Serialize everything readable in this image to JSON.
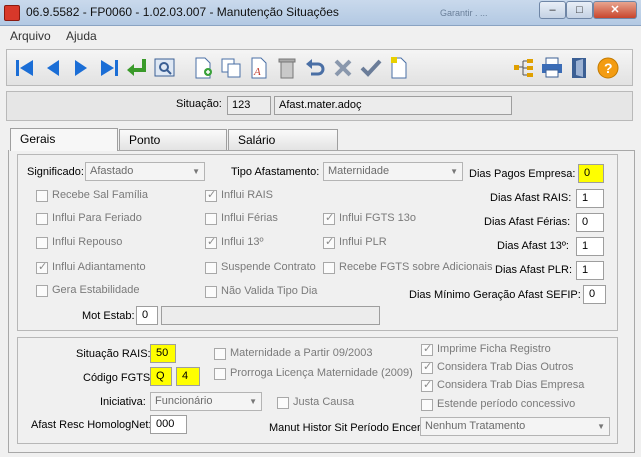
{
  "window": {
    "title": "06.9.5582 - FP0060 - 1.02.03.007 - Manutenção Situações",
    "ghost_text": "Garantir . ..."
  },
  "menu": {
    "items": [
      "Arquivo",
      "Ajuda"
    ]
  },
  "toolbar": {
    "left_icons": [
      "first-icon",
      "previous-icon",
      "next-icon",
      "last-icon",
      "goto-icon",
      "search-icon",
      "new-icon",
      "copy-icon",
      "edit-icon",
      "delete-icon",
      "undo-icon",
      "cancel-icon",
      "confirm-icon",
      "new-document-icon"
    ],
    "right_icons": [
      "tree-icon",
      "print-icon",
      "exit-icon",
      "help-icon"
    ]
  },
  "header": {
    "situacao_label": "Situação:",
    "situacao_code": "123",
    "situacao_desc": "Afast.mater.adoç"
  },
  "tabs": [
    "Gerais",
    "Ponto",
    "Salário"
  ],
  "gerais": {
    "significado_label": "Significado:",
    "significado_value": "Afastado",
    "tipo_afastamento_label": "Tipo Afastamento:",
    "tipo_afastamento_value": "Maternidade",
    "checkboxes": {
      "recebe_sal_familia": "Recebe Sal Família",
      "influi_rais": "Influi RAIS",
      "influi_para_feriado": "Influi Para Feriado",
      "influi_ferias": "Influi Férias",
      "influi_fgts_13o": "Influi FGTS 13o",
      "influi_repouso": "Influi Repouso",
      "influi_13o": "Influi 13º",
      "influi_plr": "Influi PLR",
      "influi_adiantamento": "Influi Adiantamento",
      "suspende_contrato": "Suspende Contrato",
      "recebe_fgts_adicionais": "Recebe FGTS sobre Adicionais",
      "gera_estabilidade": "Gera Estabilidade",
      "nao_valida_tipo_dia": "Não Valida Tipo Dia"
    },
    "dias_pagos_empresa_label": "Dias Pagos Empresa:",
    "dias_pagos_empresa": "0",
    "dias_afast_rais_label": "Dias Afast RAIS:",
    "dias_afast_rais": "1",
    "dias_afast_ferias_label": "Dias Afast Férias:",
    "dias_afast_ferias": "0",
    "dias_afast_13_label": "Dias Afast 13º:",
    "dias_afast_13": "1",
    "dias_afast_plr_label": "Dias Afast PLR:",
    "dias_afast_plr": "1",
    "dias_minimo_sefip_label": "Dias Mínimo Geração Afast SEFIP:",
    "dias_minimo_sefip": "0",
    "mot_estab_label": "Mot Estab:",
    "mot_estab_code": "0",
    "mot_estab_desc": ""
  },
  "bottom": {
    "situacao_rais_label": "Situação RAIS:",
    "situacao_rais": "50",
    "codigo_fgts_label": "Código FGTS:",
    "codigo_fgts_letter": "Q",
    "codigo_fgts_num": "4",
    "iniciativa_label": "Iniciativa:",
    "iniciativa_value": "Funcionário",
    "afast_resc_label": "Afast Resc HomologNet:",
    "afast_resc_value": "000",
    "checkboxes": {
      "maternidade_09_2003": "Maternidade a Partir 09/2003",
      "prorroga_licenca": "Prorroga Licença Maternidade (2009)",
      "justa_causa": "Justa Causa",
      "imprime_ficha": "Imprime Ficha Registro",
      "considera_trab_outros": "Considera Trab Dias Outros",
      "considera_trab_empresa": "Considera Trab Dias Empresa",
      "estende_periodo": "Estende período concessivo"
    },
    "manut_histor_label": "Manut Histor Sit Período Encer:",
    "manut_histor_value": "Nenhum Tratamento"
  },
  "colors": {
    "highlight": "#ffff00",
    "title_bar": "#b3c9e3"
  }
}
